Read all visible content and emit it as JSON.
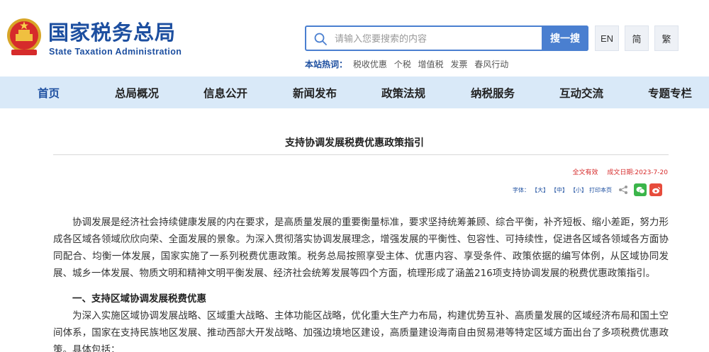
{
  "header": {
    "logo_cn": "国家税务总局",
    "logo_en": "State Taxation Administration",
    "emblem_icon": "national-emblem-icon"
  },
  "search": {
    "placeholder": "请输入您要搜索的内容",
    "button_label": "搜一搜"
  },
  "lang": {
    "en": "EN",
    "simplified": "简",
    "traditional": "繁"
  },
  "hot": {
    "label": "本站热词：",
    "items": [
      "税收优惠",
      "个税",
      "增值税",
      "发票",
      "春风行动"
    ]
  },
  "nav": {
    "items": [
      "首页",
      "总局概况",
      "信息公开",
      "新闻发布",
      "政策法规",
      "纳税服务",
      "互动交流",
      "专题专栏"
    ],
    "active_index": 0
  },
  "article": {
    "title": "支持协调发展税费优惠政策指引",
    "validity": "全文有效",
    "date": "成文日期:2023-7-20",
    "font_size_label": "字体：",
    "font_large": "【大】",
    "font_medium": "【中】",
    "font_small": "【小】",
    "print_label": "打印本页",
    "paragraph1": "协调发展是经济社会持续健康发展的内在要求，是高质量发展的重要衡量标准，要求坚持统筹兼顾、综合平衡，补齐短板、缩小差距，努力形成各区域各领域欣欣向荣、全面发展的景象。为深入贯彻落实协调发展理念，增强发展的平衡性、包容性、可持续性，促进各区域各领域各方面协同配合、均衡一体发展，国家实施了一系列税费优惠政策。税务总局按照享受主体、优惠内容、享受条件、政策依据的编写体例，从区域协同发展、城乡一体发展、物质文明和精神文明平衡发展、经济社会统筹发展等四个方面，梳理形成了涵盖216项支持协调发展的税费优惠政策指引。",
    "section1_heading": "一、支持区域协调发展税费优惠",
    "paragraph2": "为深入实施区域协调发展战略、区域重大战略、主体功能区战略，优化重大生产力布局，构建优势互补、高质量发展的区域经济布局和国土空间体系，国家在支持民族地区发展、推动西部大开发战略、加强边境地区建设，高质量建设海南自由贸易港等特定区域方面出台了多项税费优惠政策。具体包括："
  },
  "colors": {
    "brand_blue": "#1d4fa0",
    "nav_bg": "#d9e9f8",
    "accent_red": "#d62b2b"
  }
}
